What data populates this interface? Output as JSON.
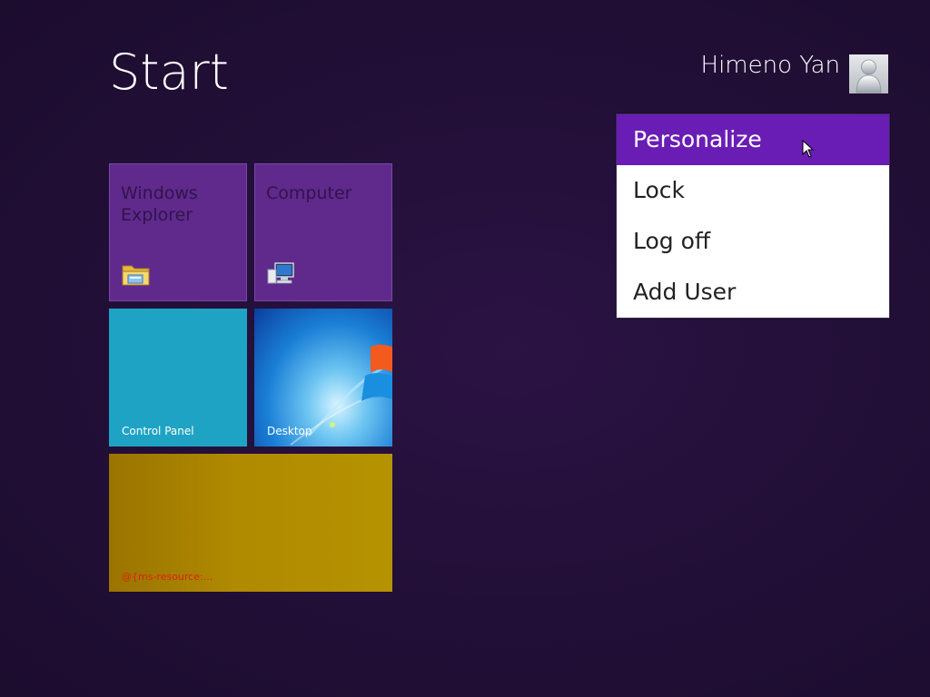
{
  "header": {
    "title": "Start"
  },
  "user": {
    "name": "Himeno Yan",
    "avatar_icon": "user-silhouette-icon"
  },
  "user_menu": {
    "items": [
      {
        "label": "Personalize",
        "active": true
      },
      {
        "label": "Lock",
        "active": false
      },
      {
        "label": "Log off",
        "active": false
      },
      {
        "label": "Add User",
        "active": false
      }
    ],
    "active_color": "#6a1db5"
  },
  "tiles": {
    "windows_explorer": {
      "title": "Windows Explorer",
      "icon": "folder-icon",
      "color": "#5f2a8c"
    },
    "computer": {
      "title": "Computer",
      "icon": "computer-icon",
      "color": "#5f2a8c"
    },
    "control_panel": {
      "label": "Control Panel",
      "color": "#1fa3c4"
    },
    "desktop": {
      "label": "Desktop",
      "color": "#1b6fd0"
    },
    "unresolved": {
      "label": "@{ms-resource:...",
      "color": "#b59000",
      "label_color": "#e02010"
    }
  },
  "colors": {
    "background": "#24103a"
  }
}
